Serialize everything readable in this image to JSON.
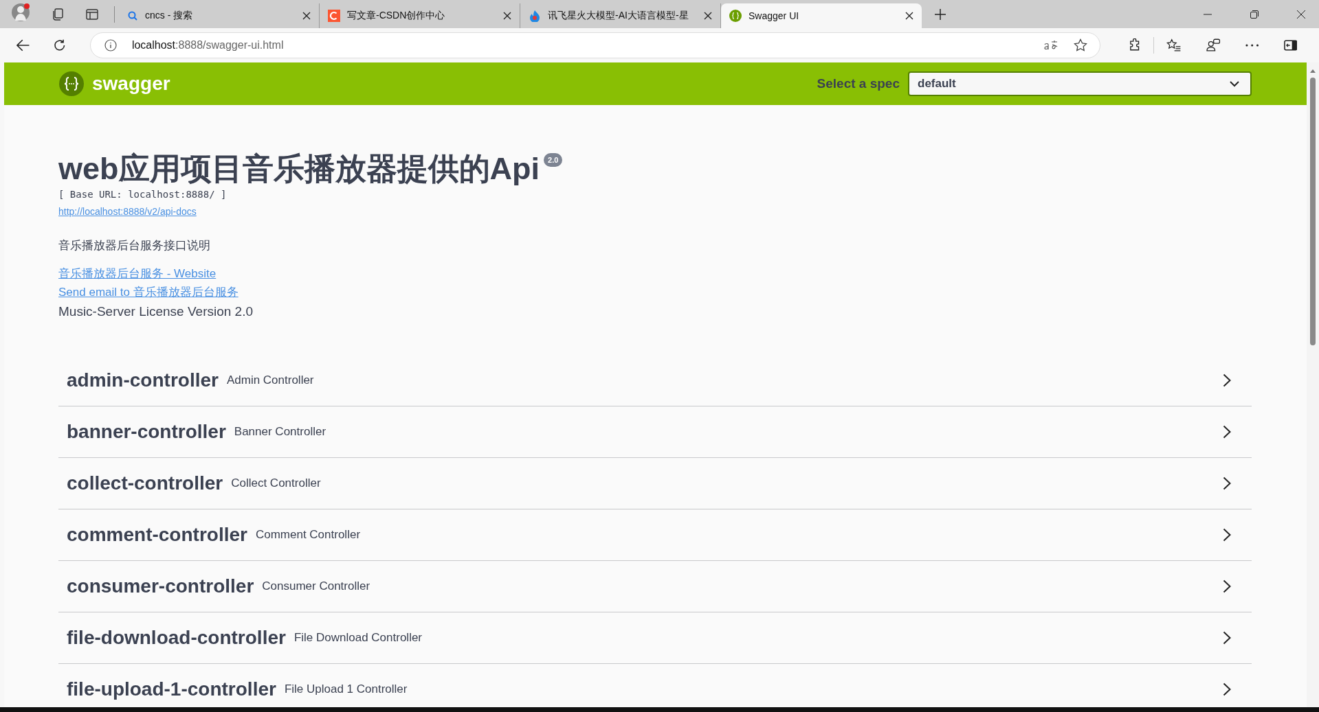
{
  "browser": {
    "tabs": [
      {
        "title": "cncs - 搜索",
        "kind": "search",
        "selected": false
      },
      {
        "title": "写文章-CSDN创作中心",
        "kind": "csdn",
        "selected": false
      },
      {
        "title": "讯飞星火大模型-AI大语言模型-星",
        "kind": "spark",
        "selected": false
      },
      {
        "title": "Swagger UI",
        "kind": "swagger",
        "selected": true
      }
    ],
    "url_host": "localhost",
    "url_rest": ":8888/swagger-ui.html"
  },
  "header": {
    "logo": "swagger",
    "spec_label": "Select a spec",
    "spec_value": "default"
  },
  "info": {
    "title": "web应用项目音乐播放器提供的Api",
    "version": "2.0",
    "base_url": "[ Base URL: localhost:8888/ ]",
    "docs_link": "http://localhost:8888/v2/api-docs",
    "description": "音乐播放器后台服务接口说明",
    "website_link": "音乐播放器后台服务 - Website",
    "email_link": "Send email to 音乐播放器后台服务",
    "license": "Music-Server License Version 2.0"
  },
  "tags": [
    {
      "name": "admin-controller",
      "description": "Admin Controller",
      "expanded": false
    },
    {
      "name": "banner-controller",
      "description": "Banner Controller",
      "expanded": false
    },
    {
      "name": "collect-controller",
      "description": "Collect Controller",
      "expanded": false
    },
    {
      "name": "comment-controller",
      "description": "Comment Controller",
      "expanded": false
    },
    {
      "name": "consumer-controller",
      "description": "Consumer Controller",
      "expanded": false
    },
    {
      "name": "file-download-controller",
      "description": "File Download Controller",
      "expanded": false
    },
    {
      "name": "file-upload-1-controller",
      "description": "File Upload 1 Controller",
      "expanded": false
    }
  ]
}
